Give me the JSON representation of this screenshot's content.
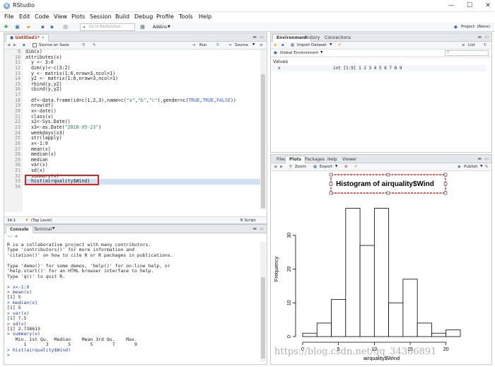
{
  "window": {
    "title": "RStudio",
    "minimize": "—",
    "maximize": "☐",
    "close": "✕"
  },
  "menu": [
    "File",
    "Edit",
    "Code",
    "View",
    "Plots",
    "Session",
    "Build",
    "Debug",
    "Profile",
    "Tools",
    "Help"
  ],
  "toolbar": {
    "goto_placeholder": "Go to file/function",
    "addins_label": "Addins",
    "project_label": "Project: (None)"
  },
  "editor": {
    "tab_label": "Untitled1*",
    "source_on_save_label": "Source on Save",
    "run_label": "Run",
    "source_label": "Source",
    "status_position": "34:1",
    "status_scope": "(Top Level)",
    "status_type": "R Script",
    "lines": [
      {
        "n": "9",
        "text": "dim(x)"
      },
      {
        "n": "10",
        "text": "attributes(x)"
      },
      {
        "n": "11",
        "text": "  y <- 3:6"
      },
      {
        "n": "12",
        "text": "  dim(y)<-c(3:2)"
      },
      {
        "n": "13",
        "text": "  y <- matrix(1:6,nrow=3,ncol=1)"
      },
      {
        "n": "14",
        "text": "  y2 <- matrix(1:6,nrow=3,ncol=1)"
      },
      {
        "n": "15",
        "text": "  rbind(y,y2)"
      },
      {
        "n": "16",
        "text": "  cbind(y,y2)"
      },
      {
        "n": "17",
        "text": ""
      },
      {
        "n": "18",
        "text": "  df<-data.frame(id=c(1,2,3),name=c(\"a\",\"b\",\"c\"),gender=c(TRUE,TRUE,FALSE))"
      },
      {
        "n": "19",
        "text": "  nrow(df)"
      },
      {
        "n": "20",
        "text": "  x<-date()"
      },
      {
        "n": "21",
        "text": "  class(x)"
      },
      {
        "n": "22",
        "text": "  x2<-Sys.Date()"
      },
      {
        "n": "23",
        "text": "  x3<-as.Date(\"2018-05-23\")"
      },
      {
        "n": "24",
        "text": "  weekdays(x3)"
      },
      {
        "n": "25",
        "text": "  str(lapply)"
      },
      {
        "n": "26",
        "text": "  x<-1:9"
      },
      {
        "n": "27",
        "text": "  mean(x)"
      },
      {
        "n": "28",
        "text": "  median(x)"
      },
      {
        "n": "29",
        "text": "  median"
      },
      {
        "n": "30",
        "text": "  var(x)"
      },
      {
        "n": "31",
        "text": "  sd(x)"
      },
      {
        "n": "32",
        "text": "  summary(x)"
      },
      {
        "n": "33",
        "text": "  hist(airquality$Wind)"
      },
      {
        "n": "34",
        "text": ""
      }
    ]
  },
  "console": {
    "tab_label": "Console",
    "terminal_tab_label": "Terminal",
    "path": "~/",
    "lines": [
      {
        "t": "o",
        "text": "R is a collaborative project with many contributors."
      },
      {
        "t": "o",
        "text": "Type 'contributors()' for more information and"
      },
      {
        "t": "o",
        "text": "'citation()' on how to cite R or R packages in publications."
      },
      {
        "t": "o",
        "text": ""
      },
      {
        "t": "o",
        "text": "Type 'demo()' for some demos, 'help()' for on-line help, or"
      },
      {
        "t": "o",
        "text": "'help.start()' for an HTML browser interface to help."
      },
      {
        "t": "o",
        "text": "Type 'q()' to quit R."
      },
      {
        "t": "o",
        "text": ""
      },
      {
        "t": "i",
        "text": "> x<-1:9"
      },
      {
        "t": "i",
        "text": "> mean(x)"
      },
      {
        "t": "o",
        "text": "[1] 5"
      },
      {
        "t": "i",
        "text": "> median(x)"
      },
      {
        "t": "o",
        "text": "[1] 5"
      },
      {
        "t": "i",
        "text": "> var(x)"
      },
      {
        "t": "o",
        "text": "[1] 7.5"
      },
      {
        "t": "i",
        "text": "> sd(x)"
      },
      {
        "t": "o",
        "text": "[1] 2.738613"
      },
      {
        "t": "i",
        "text": "> summary(x)"
      },
      {
        "t": "o",
        "text": "   Min. 1st Qu.  Median    Mean 3rd Qu.    Max. "
      },
      {
        "t": "o",
        "text": "      1       3       5       5       7       9 "
      },
      {
        "t": "i",
        "text": "> hist(airquality$Wind)"
      },
      {
        "t": "i",
        "text": "> "
      }
    ]
  },
  "environment": {
    "tabs": [
      "Environment",
      "History",
      "Connections"
    ],
    "import_label": "Import Dataset",
    "list_label": "List",
    "scope_label": "Global Environment",
    "section_label": "Values",
    "rows": [
      {
        "name": "x",
        "value": "int [1:9] 1 2 3 4 5 6 7 8 9"
      }
    ]
  },
  "plots": {
    "tabs": [
      "Files",
      "Plots",
      "Packages",
      "Help",
      "Viewer"
    ],
    "zoom_label": "Zoom",
    "export_label": "Export",
    "publish_label": "Publish"
  },
  "chart_data": {
    "type": "bar",
    "title": "Histogram of airquality$Wind",
    "xlabel": "airquality$Wind",
    "ylabel": "Frequency",
    "bins": [
      [
        0,
        2
      ],
      [
        2,
        4
      ],
      [
        4,
        6
      ],
      [
        6,
        8
      ],
      [
        8,
        10
      ],
      [
        10,
        12
      ],
      [
        12,
        14
      ],
      [
        14,
        16
      ],
      [
        16,
        18
      ],
      [
        18,
        20
      ],
      [
        20,
        22
      ]
    ],
    "values": [
      1,
      4,
      11,
      38,
      27,
      38,
      10,
      17,
      4,
      1,
      2
    ],
    "xticks": [
      0,
      5,
      10,
      15,
      20
    ],
    "yticks": [
      0,
      10,
      20,
      30
    ],
    "xlim": [
      0,
      22
    ],
    "ylim": [
      0,
      40
    ]
  },
  "watermark": "https://blog.csdn.net/qq_34386891",
  "colors": {
    "selection_box": "#e02020",
    "highlight_line": "#cfe0f5",
    "pane_border": "#c7c9cc"
  }
}
